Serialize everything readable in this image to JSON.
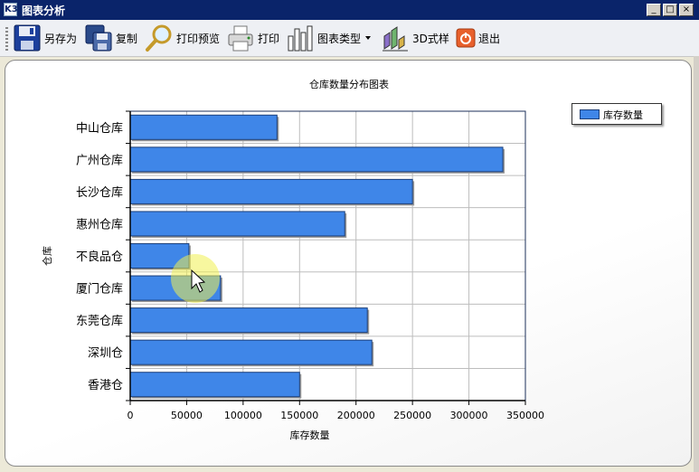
{
  "window": {
    "title": "图表分析",
    "logo_text": "K3"
  },
  "titlebar_buttons": {
    "minimize": "_",
    "maximize": "□",
    "close": "×"
  },
  "toolbar": {
    "save_as": "另存为",
    "copy": "复制",
    "print_preview": "打印预览",
    "print": "打印",
    "chart_type": "图表类型",
    "style_3d": "3D式样",
    "exit": "退出"
  },
  "colors": {
    "bar": "#3f86e8",
    "bar_border": "#1b3f7a",
    "titlebar": "#0a246a"
  },
  "chart_data": {
    "type": "bar",
    "orientation": "horizontal",
    "title": "仓库数量分布图表",
    "xlabel": "库存数量",
    "ylabel": "仓库",
    "categories": [
      "中山仓库",
      "广州仓库",
      "长沙仓库",
      "惠州仓库",
      "不良品仓",
      "厦门仓库",
      "东莞仓库",
      "深圳仓",
      "香港仓"
    ],
    "series": [
      {
        "name": "库存数量",
        "values": [
          130000,
          330000,
          250000,
          190000,
          52000,
          80000,
          210000,
          214000,
          150000
        ]
      }
    ],
    "xlim": [
      0,
      350000
    ],
    "xticks": [
      "0",
      "50000",
      "100000",
      "150000",
      "200000",
      "250000",
      "300000",
      "350000"
    ],
    "grid": true,
    "legend_position": "top-right"
  }
}
